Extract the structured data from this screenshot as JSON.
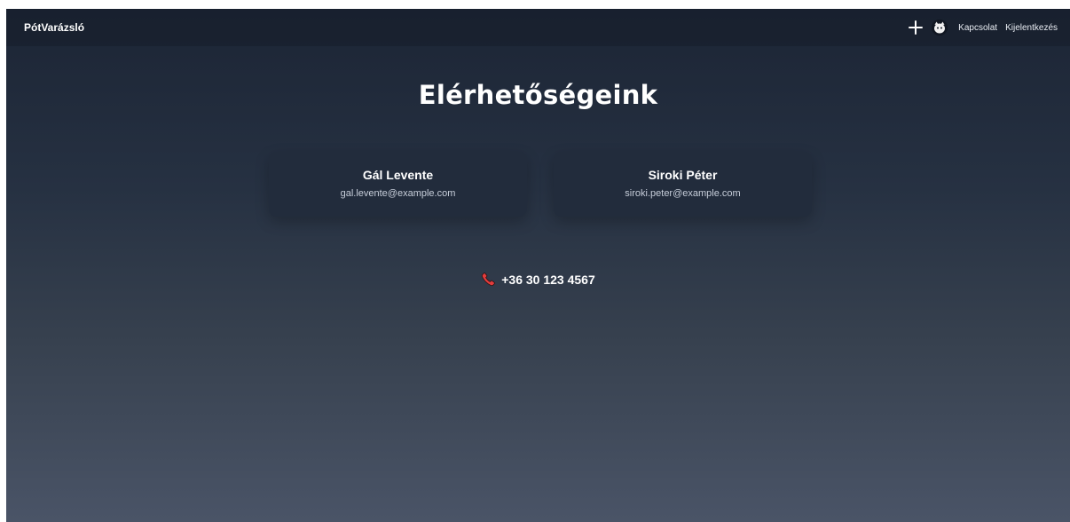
{
  "navbar": {
    "brand": "PótVarázsló",
    "links": {
      "contact": "Kapcsolat",
      "logout": "Kijelentkezés"
    },
    "icons": {
      "add": "plus-icon",
      "avatar": "avatar-icon"
    }
  },
  "main": {
    "title": "Elérhetőségeink",
    "contacts": [
      {
        "name": "Gál Levente",
        "email": "gal.levente@example.com"
      },
      {
        "name": "Siroki Péter",
        "email": "siroki.peter@example.com"
      }
    ],
    "phone": {
      "icon": "phone-icon",
      "number": "+36 30 123 4567"
    }
  },
  "colors": {
    "background_top": "#1c2535",
    "background_bottom": "#4a5467",
    "card": "#222c3c",
    "phone_icon": "#e23d3d"
  }
}
